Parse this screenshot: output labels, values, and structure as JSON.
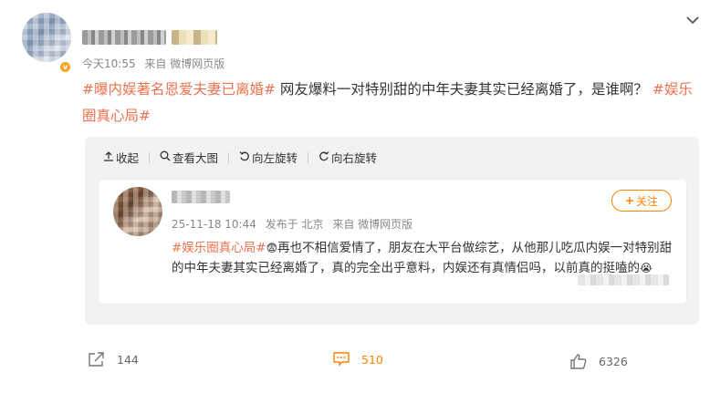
{
  "post": {
    "timestamp": "今天10:55",
    "source": "来自 微博网页版",
    "tag1": "#曝内娱著名恩爱夫妻已离婚#",
    "body": " 网友爆料一对特别甜的中年夫妻其实已经离婚了，是谁啊？ ",
    "tag2": "#娱乐圈真心局#"
  },
  "toolbar": {
    "collapse": "收起",
    "view_large": "查看大图",
    "rotate_left": "向左旋转",
    "rotate_right": "向右旋转"
  },
  "quote": {
    "follow_label": "关注",
    "timestamp": "25-11-18 10:44",
    "location": "发布于 北京",
    "source": "来自 微博网页版",
    "tag": "#娱乐圈真心局#",
    "emoji1": "😨",
    "body": "再也不相信爱情了，朋友在大平台做综艺，从他那儿吃瓜内娱一对特别甜的中年夫妻其实已经离婚了，真的完全出乎意料，内娱还有真情侣吗，以前真的挺嗑的",
    "emoji2": "😭"
  },
  "actions": {
    "share_count": "144",
    "comment_count": "510",
    "like_count": "6326"
  },
  "colors": {
    "tag": "#eb7350",
    "accent": "#ff8200",
    "quote_bg": "#f2f2f5"
  },
  "icons": {
    "chevron": "chevron-down-icon",
    "share": "share-icon",
    "comment": "comment-icon",
    "like": "thumbs-up-icon"
  }
}
